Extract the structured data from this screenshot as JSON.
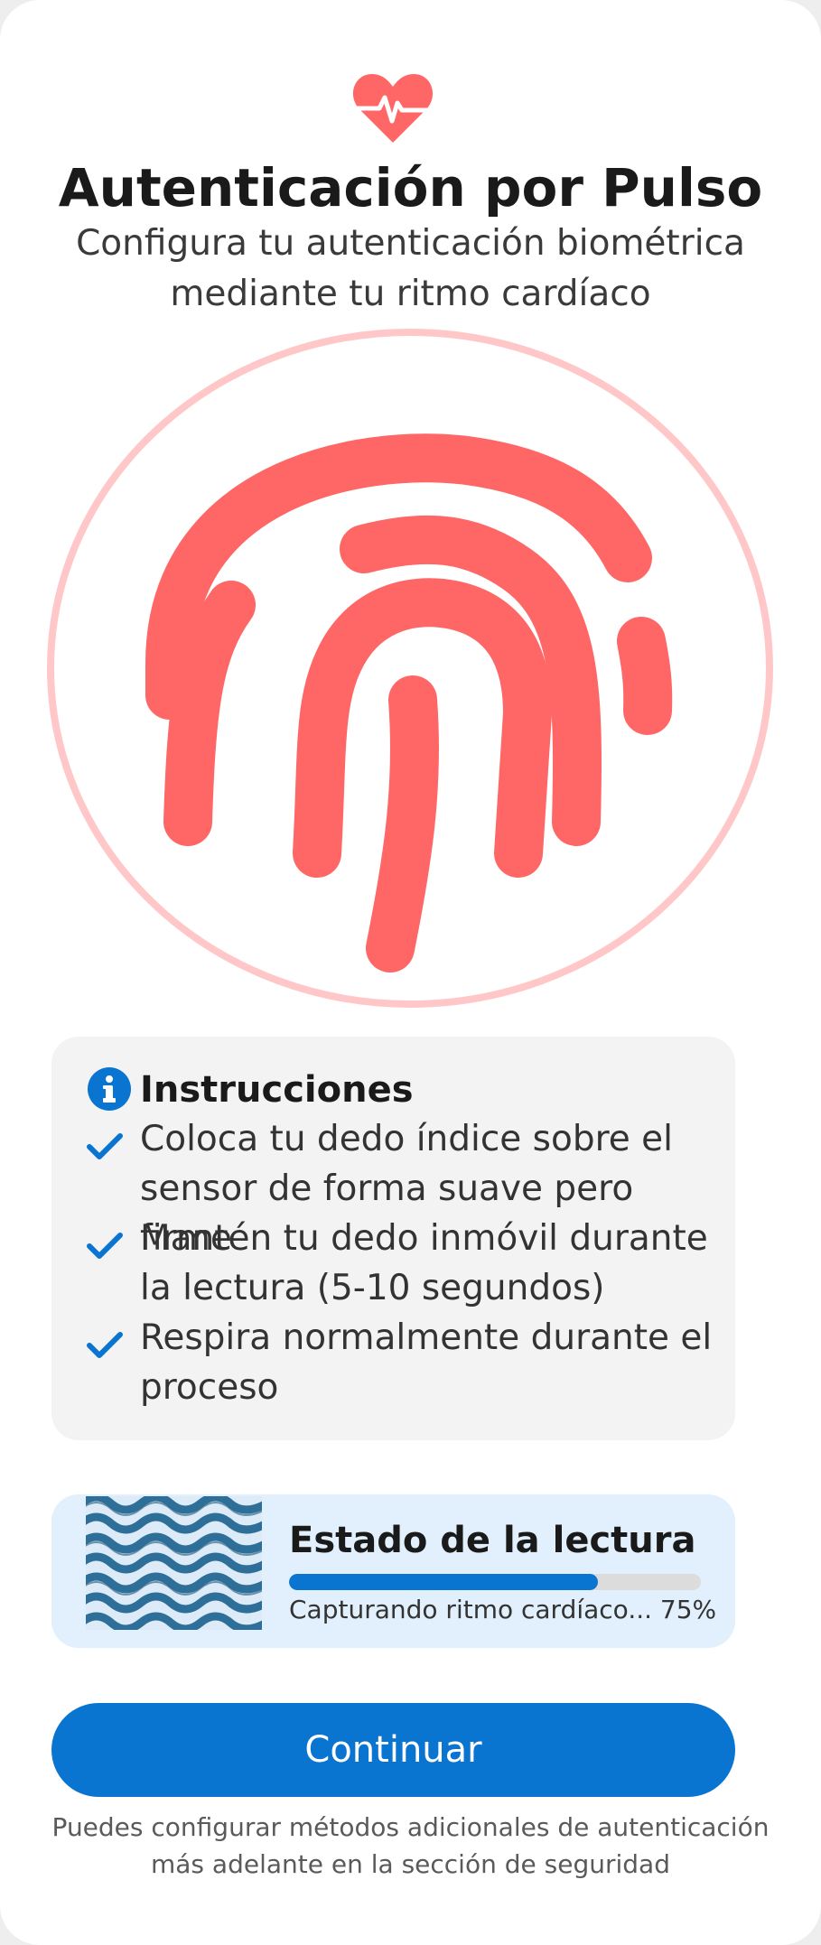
{
  "header": {
    "icon": "heart-pulse-icon",
    "title": "Autenticación por Pulso",
    "subtitle": "Configura tu autenticación biométrica mediante tu ritmo cardíaco"
  },
  "scanner": {
    "icon": "fingerprint-icon",
    "color": "#ff6666",
    "ring_color": "#ffc7c7"
  },
  "instructions": {
    "title": "Instrucciones",
    "icon": "info-icon",
    "items": [
      "Coloca tu dedo índice sobre el sensor de forma suave pero firme",
      "Mantén tu dedo inmóvil durante la lectura (5-10 segundos)",
      "Respira normalmente durante el proceso"
    ]
  },
  "status": {
    "title": "Estado de la lectura",
    "progress": 0.75,
    "text": "Capturando ritmo cardíaco... 75%"
  },
  "actions": {
    "continue_label": "Continuar"
  },
  "footer": {
    "note": "Puedes configurar métodos adicionales de autenticación más adelante en la sección de seguridad"
  },
  "colors": {
    "accent": "#0a74d1",
    "brand": "#ff6666"
  }
}
